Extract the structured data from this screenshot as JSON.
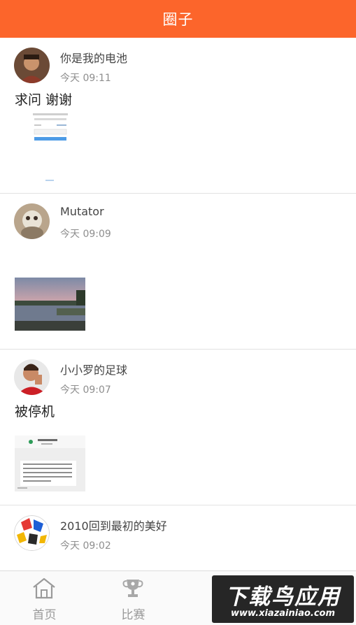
{
  "header": {
    "title": "圈子"
  },
  "posts": [
    {
      "author": "你是我的电池",
      "time": "今天 09:11",
      "content": "求问 谢谢",
      "image": "screenshot-thumbnail"
    },
    {
      "author": "Mutator",
      "time": "今天 09:09",
      "content": "",
      "image": "lake-sunset-photo"
    },
    {
      "author": "小小罗的足球",
      "time": "今天 09:07",
      "content": "被停机",
      "image": "sms-screenshot-thumbnail"
    },
    {
      "author": "2010回到最初的美好",
      "time": "今天 09:02",
      "content": ""
    }
  ],
  "tabbar": {
    "items": [
      {
        "label": "首页",
        "icon": "home-icon"
      },
      {
        "label": "比赛",
        "icon": "trophy-icon"
      }
    ]
  },
  "watermark": {
    "title": "下载鸟应用",
    "url": "www.xiazainiao.com"
  },
  "colors": {
    "accent": "#fc652b",
    "divider": "#e2e2e2",
    "time": "#8e8e8e"
  }
}
